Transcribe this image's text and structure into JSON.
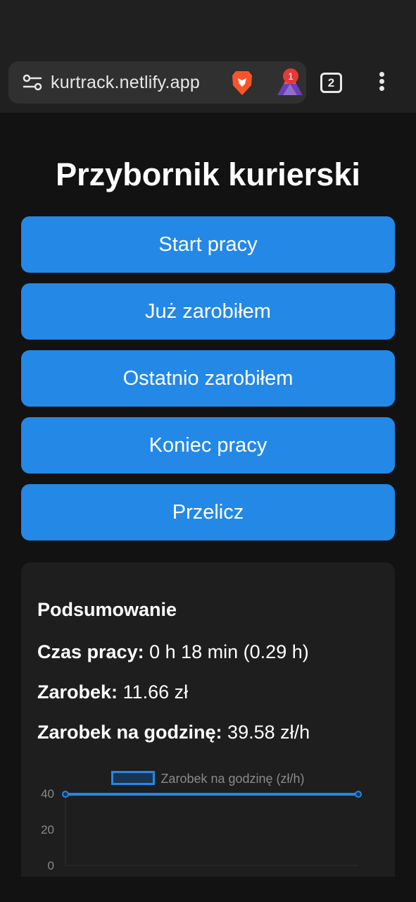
{
  "browser": {
    "url": "kurtrack.netlify.app",
    "notification_count": "1",
    "tab_count": "2",
    "colors": {
      "bar": "#202020",
      "pill": "#303030",
      "badge": "#e53935"
    }
  },
  "page": {
    "title": "Przybornik kurierski",
    "buttons": [
      "Start pracy",
      "Już zarobiłem",
      "Ostatnio zarobiłem",
      "Koniec pracy",
      "Przelicz"
    ],
    "accent": "#2488e6"
  },
  "summary": {
    "title": "Podsumowanie",
    "work_time_label": "Czas pracy:",
    "work_time_value": "0 h 18 min (0.29 h)",
    "earnings_label": "Zarobek:",
    "earnings_value": "11.66 zł",
    "hourly_label": "Zarobek na godzinę:",
    "hourly_value": "39.58 zł/h"
  },
  "chart_data": {
    "type": "line",
    "series": [
      {
        "name": "Zarobek na godzinę (zł/h)",
        "values": [
          39.58,
          39.58
        ]
      }
    ],
    "y_ticks": [
      "40",
      "20",
      "0"
    ],
    "ylim": [
      0,
      40
    ],
    "legend": "top-center"
  }
}
